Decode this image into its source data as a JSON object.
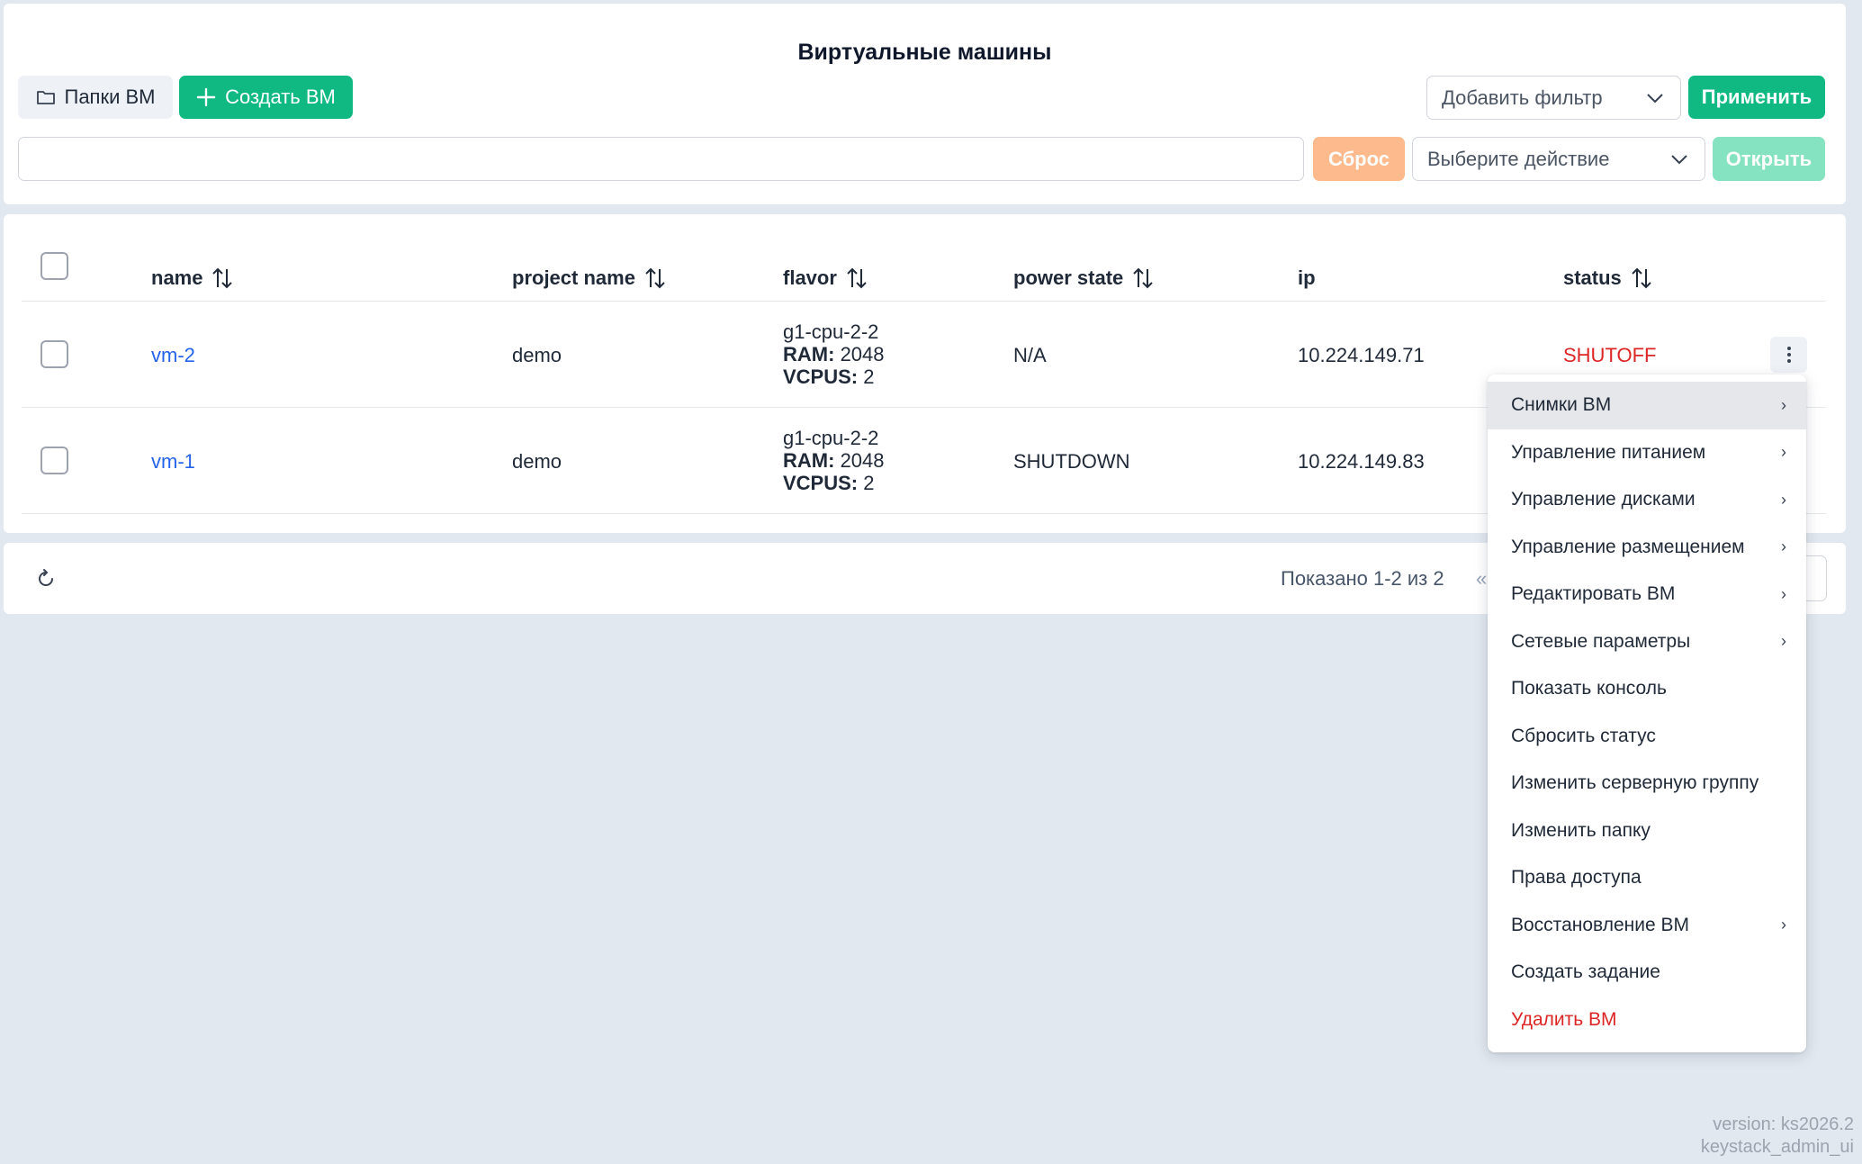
{
  "header": {
    "title": "Виртуальные машины",
    "folders_label": "Папки ВМ",
    "create_label": "Создать ВМ",
    "filter_placeholder": "Добавить фильтр",
    "apply_label": "Применить",
    "reset_label": "Сброс",
    "action_placeholder": "Выберите действие",
    "open_label": "Открыть",
    "search_value": ""
  },
  "table": {
    "columns": [
      "name",
      "project name",
      "flavor",
      "power state",
      "ip",
      "status"
    ],
    "rows": [
      {
        "name": "vm-2",
        "project": "demo",
        "flavor": "g1-cpu-2-2",
        "ram_label": "RAM:",
        "ram": "2048",
        "vcpus_label": "VCPUS:",
        "vcpus": "2",
        "power_state": "N/A",
        "ip": "10.224.149.71",
        "status": "SHUTOFF"
      },
      {
        "name": "vm-1",
        "project": "demo",
        "flavor": "g1-cpu-2-2",
        "ram_label": "RAM:",
        "ram": "2048",
        "vcpus_label": "VCPUS:",
        "vcpus": "2",
        "power_state": "SHUTDOWN",
        "ip": "10.224.149.83",
        "status": ""
      }
    ]
  },
  "footer": {
    "pager_text": "Показано 1-2 из 2",
    "pager_prev": "«"
  },
  "context_menu": {
    "items": [
      {
        "label": "Снимки ВМ",
        "submenu": true
      },
      {
        "label": "Управление питанием",
        "submenu": true
      },
      {
        "label": "Управление дисками",
        "submenu": true
      },
      {
        "label": "Управление размещением",
        "submenu": true
      },
      {
        "label": "Редактировать ВМ",
        "submenu": true
      },
      {
        "label": "Сетевые параметры",
        "submenu": true
      },
      {
        "label": "Показать консоль",
        "submenu": false
      },
      {
        "label": "Сбросить статус",
        "submenu": false
      },
      {
        "label": "Изменить серверную группу",
        "submenu": false
      },
      {
        "label": "Изменить папку",
        "submenu": false
      },
      {
        "label": "Права доступа",
        "submenu": false
      },
      {
        "label": "Восстановление ВМ",
        "submenu": true
      },
      {
        "label": "Создать задание",
        "submenu": false
      },
      {
        "label": "Удалить ВМ",
        "submenu": false
      }
    ]
  },
  "version": {
    "line1": "version: ks2026.2",
    "line2": "keystack_admin_ui"
  },
  "colors": {
    "accent": "#10b981",
    "link": "#2563eb",
    "danger": "#dc2626",
    "background": "#e2e8f0"
  },
  "icons": {
    "folders": "folder-icon",
    "create": "plus-icon",
    "dropdown": "chevron-down-icon",
    "sort": "sort-icon",
    "row_menu": "kebab-icon",
    "submenu": "chevron-right-icon",
    "refresh": "refresh-icon"
  }
}
